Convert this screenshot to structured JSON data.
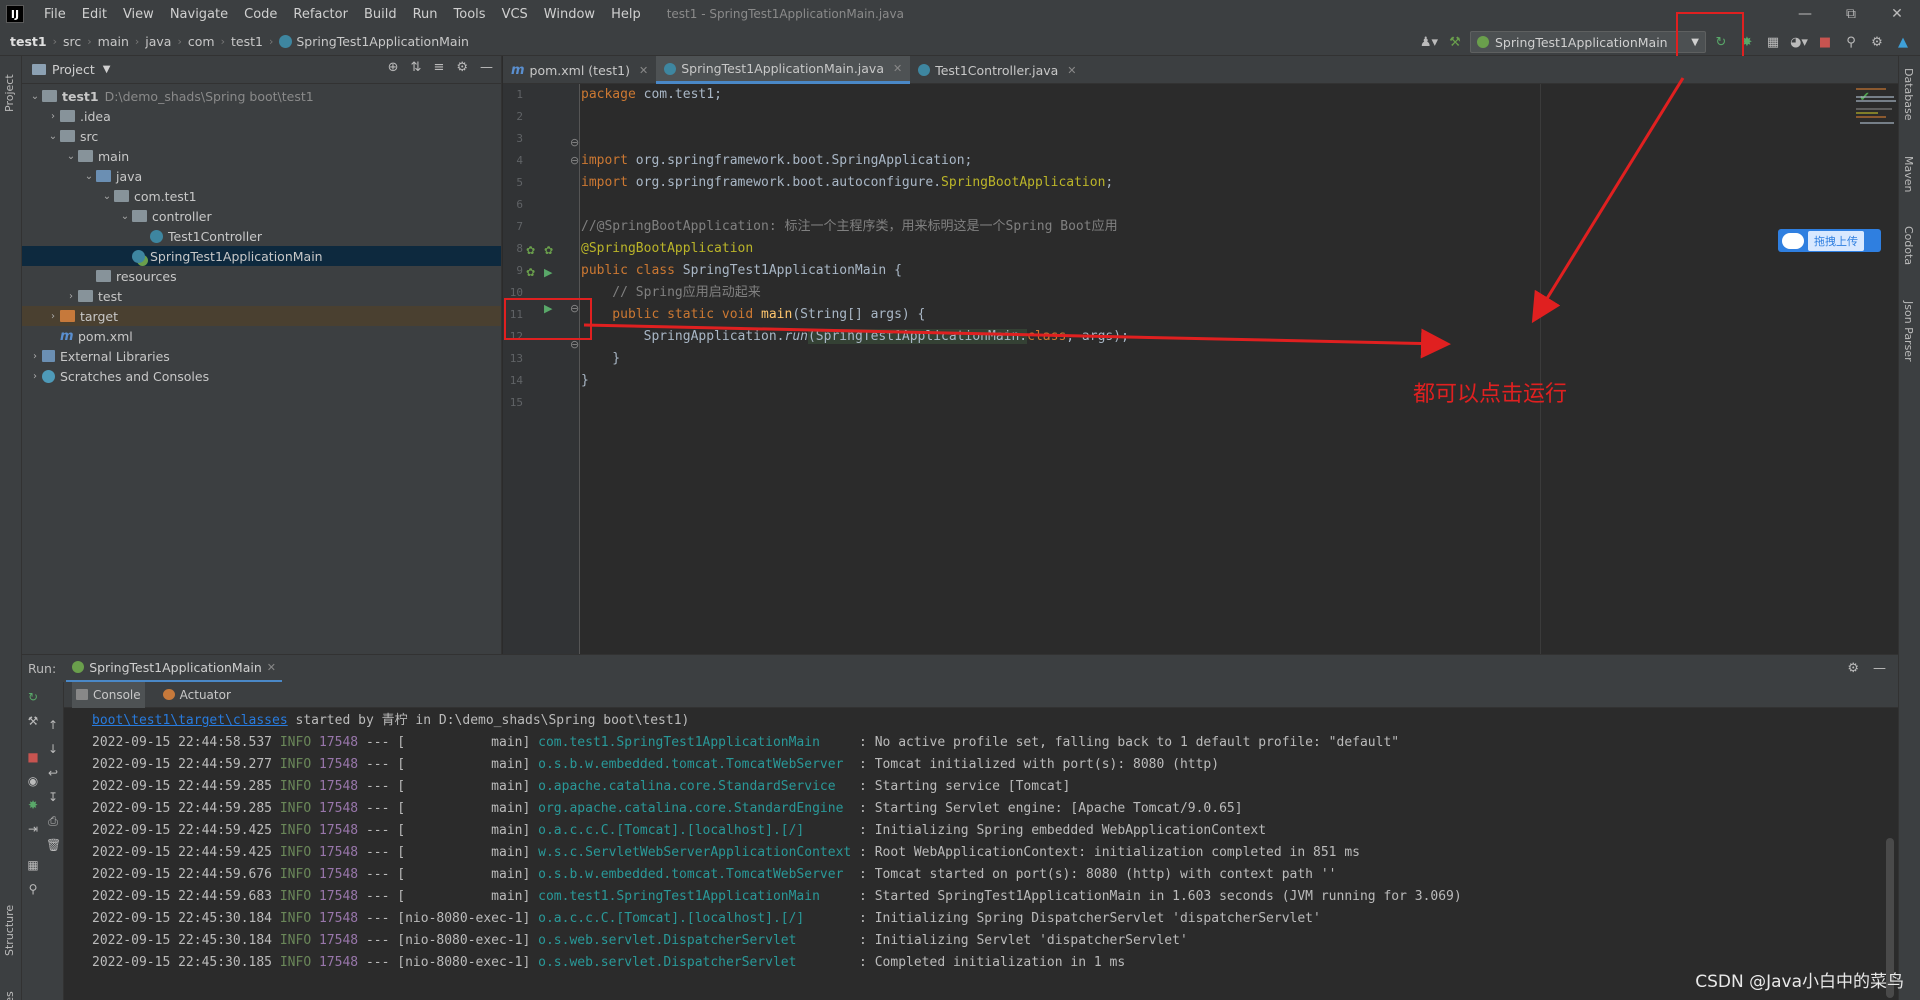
{
  "menubar": {
    "logo": "IJ",
    "items": [
      "File",
      "Edit",
      "View",
      "Navigate",
      "Code",
      "Refactor",
      "Build",
      "Run",
      "Tools",
      "VCS",
      "Window",
      "Help"
    ],
    "window_title": "test1 - SpringTest1ApplicationMain.java"
  },
  "breadcrumb": [
    "test1",
    "src",
    "main",
    "java",
    "com",
    "test1",
    "SpringTest1ApplicationMain"
  ],
  "run_config": {
    "label": "SpringTest1ApplicationMain"
  },
  "left_strip": {
    "project": "Project",
    "structure": "Structure",
    "favorites": "Favorites"
  },
  "right_strip": {
    "database": "Database",
    "maven": "Maven",
    "codota": "Codota",
    "json_parser": "Json Parser"
  },
  "project": {
    "header": "Project",
    "tree": [
      {
        "depth": 0,
        "chev": "⌄",
        "icon": "folder",
        "label": "test1",
        "hint": "D:\\demo_shads\\Spring boot\\test1",
        "bold": true
      },
      {
        "depth": 1,
        "chev": "›",
        "icon": "folder",
        "label": ".idea"
      },
      {
        "depth": 1,
        "chev": "⌄",
        "icon": "folder",
        "label": "src"
      },
      {
        "depth": 2,
        "chev": "⌄",
        "icon": "folder",
        "label": "main"
      },
      {
        "depth": 3,
        "chev": "⌄",
        "icon": "src",
        "label": "java"
      },
      {
        "depth": 4,
        "chev": "⌄",
        "icon": "folder",
        "label": "com.test1"
      },
      {
        "depth": 5,
        "chev": "⌄",
        "icon": "folder",
        "label": "controller"
      },
      {
        "depth": 6,
        "chev": "",
        "icon": "java",
        "label": "Test1Controller"
      },
      {
        "depth": 5,
        "chev": "",
        "icon": "springmain",
        "label": "SpringTest1ApplicationMain",
        "selected": true
      },
      {
        "depth": 3,
        "chev": "",
        "icon": "folder",
        "label": "resources"
      },
      {
        "depth": 2,
        "chev": "›",
        "icon": "folder",
        "label": "test"
      },
      {
        "depth": 1,
        "chev": "›",
        "icon": "orange",
        "label": "target",
        "target": true
      },
      {
        "depth": 1,
        "chev": "",
        "icon": "maven",
        "label": "pom.xml"
      },
      {
        "depth": 0,
        "chev": "›",
        "icon": "libs",
        "label": "External Libraries"
      },
      {
        "depth": 0,
        "chev": "›",
        "icon": "scratch",
        "label": "Scratches and Consoles"
      }
    ]
  },
  "tabs": [
    {
      "icon": "m",
      "label": "pom.xml (test1)"
    },
    {
      "icon": "spring",
      "label": "SpringTest1ApplicationMain.java",
      "active": true
    },
    {
      "icon": "java",
      "label": "Test1Controller.java"
    }
  ],
  "editor": {
    "line_numbers": [
      "1",
      "2",
      "3",
      "4",
      "5",
      "6",
      "7",
      "8",
      "9",
      "10",
      "11",
      "12",
      "13",
      "14",
      "15"
    ],
    "lines": {
      "l1_kw": "package",
      "l1_rest": " com.test1;",
      "l4_kw": "import",
      "l4_rest": " org.springframework.boot.SpringApplication;",
      "l5_kw": "import",
      "l5_rest": " org.springframework.boot.autoconfigure.",
      "l5_ann": "SpringBootApplication",
      "l5_end": ";",
      "l7": "//@SpringBootApplication: 标注一个主程序类，用来标明这是一个Spring Boot应用",
      "l8": "@SpringBootApplication",
      "l9_kw": "public class",
      "l9_cls": " SpringTest1ApplicationMain",
      "l9_end": " {",
      "l10": "    // Spring应用启动起来",
      "l11_kw": "    public static void",
      "l11_fn": " main",
      "l11_end": "(String[] args) {",
      "l12_a": "        SpringApplication.",
      "l12_run": "run",
      "l12_b": "(SpringTest1ApplicationMain.",
      "l12_kw": "class",
      "l12_c": ", args);",
      "l13": "    }",
      "l14": "}"
    }
  },
  "upload_widget": {
    "label": "拖拽上传"
  },
  "annotation": "都可以点击运行",
  "run_panel": {
    "label": "Run:",
    "tab": "SpringTest1ApplicationMain",
    "subtabs": [
      "Console",
      "Actuator"
    ]
  },
  "console": {
    "first_line_link": "boot\\test1\\target\\classes",
    "first_line_rest": " started by 青柠 in D:\\demo_shads\\Spring boot\\test1)",
    "lines": [
      {
        "ts": "2022-09-15 22:44:58.537",
        "lvl": "INFO",
        "pid": "17548",
        "thread": "--- [           main]",
        "logger": "com.test1.SpringTest1ApplicationMain    ",
        "msg": " : No active profile set, falling back to 1 default profile: \"default\""
      },
      {
        "ts": "2022-09-15 22:44:59.277",
        "lvl": "INFO",
        "pid": "17548",
        "thread": "--- [           main]",
        "logger": "o.s.b.w.embedded.tomcat.TomcatWebServer ",
        "msg": " : Tomcat initialized with port(s): 8080 (http)"
      },
      {
        "ts": "2022-09-15 22:44:59.285",
        "lvl": "INFO",
        "pid": "17548",
        "thread": "--- [           main]",
        "logger": "o.apache.catalina.core.StandardService  ",
        "msg": " : Starting service [Tomcat]"
      },
      {
        "ts": "2022-09-15 22:44:59.285",
        "lvl": "INFO",
        "pid": "17548",
        "thread": "--- [           main]",
        "logger": "org.apache.catalina.core.StandardEngine ",
        "msg": " : Starting Servlet engine: [Apache Tomcat/9.0.65]"
      },
      {
        "ts": "2022-09-15 22:44:59.425",
        "lvl": "INFO",
        "pid": "17548",
        "thread": "--- [           main]",
        "logger": "o.a.c.c.C.[Tomcat].[localhost].[/]      ",
        "msg": " : Initializing Spring embedded WebApplicationContext"
      },
      {
        "ts": "2022-09-15 22:44:59.425",
        "lvl": "INFO",
        "pid": "17548",
        "thread": "--- [           main]",
        "logger": "w.s.c.ServletWebServerApplicationContext",
        "msg": " : Root WebApplicationContext: initialization completed in 851 ms"
      },
      {
        "ts": "2022-09-15 22:44:59.676",
        "lvl": "INFO",
        "pid": "17548",
        "thread": "--- [           main]",
        "logger": "o.s.b.w.embedded.tomcat.TomcatWebServer ",
        "msg": " : Tomcat started on port(s): 8080 (http) with context path ''"
      },
      {
        "ts": "2022-09-15 22:44:59.683",
        "lvl": "INFO",
        "pid": "17548",
        "thread": "--- [           main]",
        "logger": "com.test1.SpringTest1ApplicationMain    ",
        "msg": " : Started SpringTest1ApplicationMain in 1.603 seconds (JVM running for 3.069)"
      },
      {
        "ts": "2022-09-15 22:45:30.184",
        "lvl": "INFO",
        "pid": "17548",
        "thread": "--- [nio-8080-exec-1]",
        "logger": "o.a.c.c.C.[Tomcat].[localhost].[/]      ",
        "msg": " : Initializing Spring DispatcherServlet 'dispatcherServlet'"
      },
      {
        "ts": "2022-09-15 22:45:30.184",
        "lvl": "INFO",
        "pid": "17548",
        "thread": "--- [nio-8080-exec-1]",
        "logger": "o.s.web.servlet.DispatcherServlet       ",
        "msg": " : Initializing Servlet 'dispatcherServlet'"
      },
      {
        "ts": "2022-09-15 22:45:30.185",
        "lvl": "INFO",
        "pid": "17548",
        "thread": "--- [nio-8080-exec-1]",
        "logger": "o.s.web.servlet.DispatcherServlet       ",
        "msg": " : Completed initialization in 1 ms"
      }
    ]
  },
  "watermark": "CSDN @Java小白中的菜鸟",
  "colors": {
    "annotation_red": "#e02020",
    "accent_blue": "#4a88c7"
  }
}
